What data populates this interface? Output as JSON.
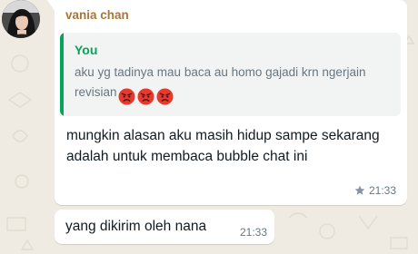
{
  "message": {
    "sender_name": "vania chan",
    "sender_color": "#a5763a",
    "avatar_icon": "profile-photo",
    "quote": {
      "author": "You",
      "author_color": "#06a35a",
      "text": "aku yg tadinya mau baca au homo gajadi krn ngerjain revisian",
      "emojis": [
        "angry-face",
        "angry-face",
        "angry-face"
      ]
    },
    "text": "mungkin alasan aku masih hidup sampe sekarang adalah untuk membaca bubble chat ini",
    "starred": true,
    "star_icon": "star-icon",
    "time": "21:33"
  },
  "second_message": {
    "text": "yang dikirim oleh nana",
    "time": "21:33"
  },
  "colors": {
    "chat_background": "#efeae2",
    "bubble": "#ffffff",
    "quote_background": "#f2f3f3"
  }
}
